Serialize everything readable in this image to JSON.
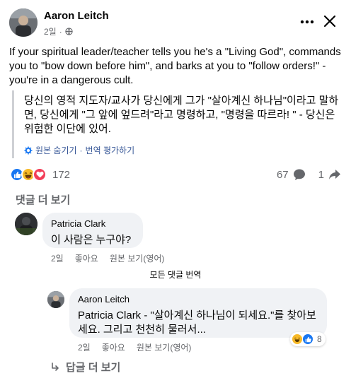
{
  "post": {
    "author": "Aaron Leitch",
    "time": "2일",
    "body": "If your spiritual leader/teacher tells you he's a \"Living God\", commands you to \"bow down before him\", and barks at you to \"follow orders!\" - you're in a dangerous cult.",
    "translation": "당신의 영적 지도자/교사가 당신에게 그가 \"살아계신 하나님\"이라고 말하면, 당신에게 \"그 앞에 엎드려\"라고 명령하고, \"명령을 따르라! \" - 당신은 위험한 이단에 있어.",
    "hide_original": "원본 숨기기",
    "separator": "·",
    "rate_translation": "번역 평가하기",
    "reaction_count": "172",
    "comment_count": "67",
    "share_count": "1"
  },
  "comments_header": "댓글 더 보기",
  "comments": [
    {
      "author": "Patricia Clark",
      "text": "이 사람은 누구야?",
      "time": "2일",
      "like": "좋아요",
      "see_original": "원본 보기(영어)"
    }
  ],
  "translate_all": "모든 댓글 번역",
  "reply": {
    "author": "Aaron Leitch",
    "text": "Patricia Clark - \"살아계신 하나님이 되세요.\"를 찾아보세요. 그리고 천천히 물러서...",
    "time": "2일",
    "like": "좋아요",
    "see_original": "원본 보기(영어)",
    "reaction_count": "8"
  },
  "more_replies": "답글 더 보기",
  "colors": {
    "like": "#1877f2",
    "haha": "#f7b928",
    "love": "#f33e58",
    "secondary_text": "#65676b",
    "bubble": "#f0f2f5"
  },
  "icons": [
    "globe-icon",
    "more-options-icon",
    "close-icon",
    "settings-icon",
    "like-icon",
    "haha-icon",
    "love-icon",
    "comment-icon",
    "share-icon",
    "reply-arrow-icon"
  ]
}
